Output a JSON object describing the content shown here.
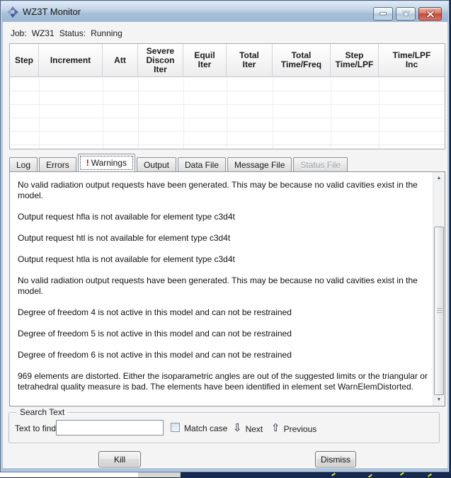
{
  "window": {
    "title": "WZ3T Monitor"
  },
  "status_line": {
    "job_label": "Job:",
    "job_name": "WZ31",
    "status_label": "Status:",
    "status_value": "Running"
  },
  "table": {
    "columns": [
      {
        "label": "Step"
      },
      {
        "label": "Increment"
      },
      {
        "label": "Att"
      },
      {
        "label": "Severe\nDiscon\nIter"
      },
      {
        "label": "Equil\nIter"
      },
      {
        "label": "Total\nIter"
      },
      {
        "label": "Total\nTime/Freq"
      },
      {
        "label": "Step\nTime/LPF"
      },
      {
        "label": "Time/LPF\nInc"
      }
    ],
    "rows": []
  },
  "tabs": {
    "items": [
      {
        "label": "Log",
        "state": "normal"
      },
      {
        "label": "Errors",
        "state": "normal"
      },
      {
        "label": "Warnings",
        "prefix": "!",
        "state": "selected"
      },
      {
        "label": "Output",
        "state": "normal"
      },
      {
        "label": "Data File",
        "state": "normal"
      },
      {
        "label": "Message File",
        "state": "normal"
      },
      {
        "label": "Status File",
        "state": "disabled"
      }
    ]
  },
  "messages": [
    "No valid radiation output requests have been generated. This may be because no valid cavities exist in the model.",
    "Output request hfla is not available for element type c3d4t",
    "Output request htl is not available for element type c3d4t",
    "Output request htla is not available for element type c3d4t",
    "No valid radiation output requests have been generated. This may be because no valid cavities exist in the model.",
    "Degree of freedom 4 is not active in this model and can not be restrained",
    "Degree of freedom 5 is not active in this model and can not be restrained",
    "Degree of freedom 6 is not active in this model and can not be restrained",
    "969 elements are distorted. Either the isoparametric angles are out of the suggested limits or the triangular or tetrahedral quality measure is bad. The elements have been identified in element set WarnElemDistorted."
  ],
  "search": {
    "group_label": "Search Text",
    "find_label": "Text to find:",
    "find_value": "",
    "match_case_label": "Match case",
    "next_icon": "⇩",
    "next_label": "Next",
    "previous_icon": "⇧",
    "previous_label": "Previous"
  },
  "actions": {
    "kill_label": "Kill",
    "dismiss_label": "Dismiss"
  },
  "colors": {
    "titlebar_blue": "#abc2dc",
    "close_button_red": "#c2483a",
    "warning_exclamation_red": "#cc0000",
    "viewport_navy": "#16294e"
  }
}
